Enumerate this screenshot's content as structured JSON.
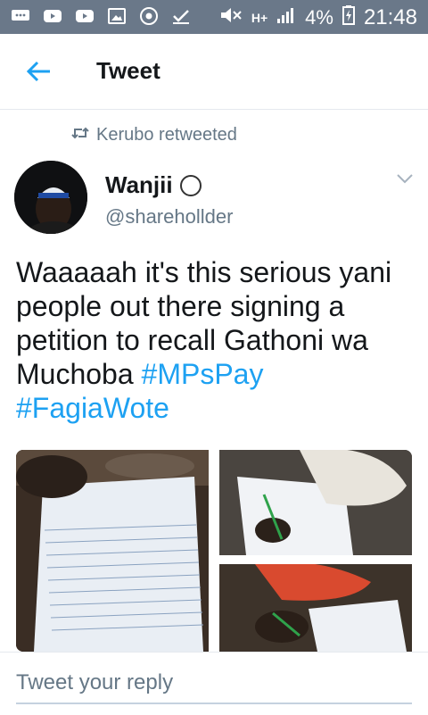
{
  "status_bar": {
    "icons_left": [
      "message-icon",
      "youtube-icon",
      "youtube-icon",
      "image-icon",
      "chrome-icon",
      "check-icon"
    ],
    "network": "H+",
    "battery": "4%",
    "time": "21:48"
  },
  "app_bar": {
    "title": "Tweet"
  },
  "tweet": {
    "retweeted_by": "Kerubo retweeted",
    "author_name": "Wanjii",
    "author_handle": "@sharehollder",
    "text_main": "Waaaaah it's this serious yani people out there signing a petition to recall Gathoni wa Muchoba ",
    "hashtag1": "#MPsPay",
    "hashtag2": "#FagiaWote"
  },
  "reply": {
    "placeholder": "Tweet your reply"
  },
  "colors": {
    "accent": "#1da1f2",
    "status_bar": "#6a7889"
  }
}
